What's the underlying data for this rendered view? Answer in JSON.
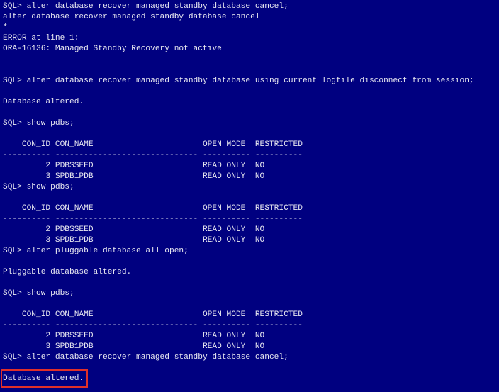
{
  "terminal": {
    "lines": [
      "SQL> alter database recover managed standby database cancel;",
      "alter database recover managed standby database cancel",
      "*",
      "ERROR at line 1:",
      "ORA-16136: Managed Standby Recovery not active",
      "",
      "",
      "SQL> alter database recover managed standby database using current logfile disconnect from session;",
      "",
      "Database altered.",
      "",
      "SQL> show pdbs;",
      "",
      "    CON_ID CON_NAME                       OPEN MODE  RESTRICTED",
      "---------- ------------------------------ ---------- ----------",
      "         2 PDB$SEED                       READ ONLY  NO",
      "         3 SPDB1PDB                       READ ONLY  NO",
      "SQL> show pdbs;",
      "",
      "    CON_ID CON_NAME                       OPEN MODE  RESTRICTED",
      "---------- ------------------------------ ---------- ----------",
      "         2 PDB$SEED                       READ ONLY  NO",
      "         3 SPDB1PDB                       READ ONLY  NO",
      "SQL> alter pluggable database all open;",
      "",
      "Pluggable database altered.",
      "",
      "SQL> show pdbs;",
      "",
      "    CON_ID CON_NAME                       OPEN MODE  RESTRICTED",
      "---------- ------------------------------ ---------- ----------",
      "         2 PDB$SEED                       READ ONLY  NO",
      "         3 SPDB1PDB                       READ ONLY  NO",
      "SQL> alter database recover managed standby database cancel;",
      "",
      "Database altered."
    ]
  },
  "colors": {
    "background": "#000080",
    "text": "#e8e8f0",
    "highlight_border": "#e0302a"
  }
}
